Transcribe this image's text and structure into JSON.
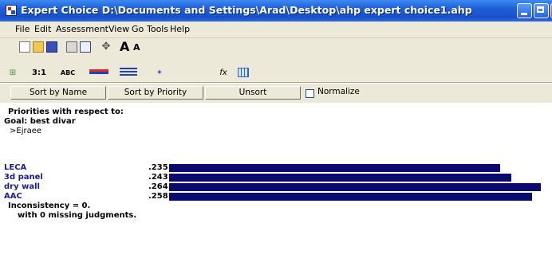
{
  "window": {
    "title": "Expert Choice    D:\\Documents and Settings\\Arad\\Desktop\\ahp expert choice1.ahp"
  },
  "menu": [
    "File",
    "Edit",
    "Assessment",
    "View",
    "Go",
    "Tools",
    "Help"
  ],
  "toolbar": {
    "icons": [
      "new-file-icon",
      "open-folder-icon",
      "save-icon",
      "print-icon",
      "print-preview-icon",
      "move-icon",
      "increase-font-icon",
      "decrease-font-icon"
    ],
    "tabs": [
      "",
      "3:1",
      "ABC",
      "",
      "",
      "",
      "fx",
      ""
    ]
  },
  "controls": {
    "sort_name": "Sort by Name",
    "sort_priority": "Sort by Priority",
    "unsort": "Unsort",
    "normalize": "Normalize"
  },
  "content": {
    "priorities_header": "Priorities with respect to:",
    "goal": "Goal: best divar",
    "node": ">Ejraee",
    "items": [
      {
        "name": "LECA",
        "value": ".235",
        "fraction": 0.235
      },
      {
        "name": "3d panel",
        "value": ".243",
        "fraction": 0.243
      },
      {
        "name": "dry wall",
        "value": ".264",
        "fraction": 0.264
      },
      {
        "name": "AAC",
        "value": ".258",
        "fraction": 0.258
      }
    ],
    "inconsistency": "Inconsistency = 0.",
    "missing": "with 0  missing judgments."
  }
}
